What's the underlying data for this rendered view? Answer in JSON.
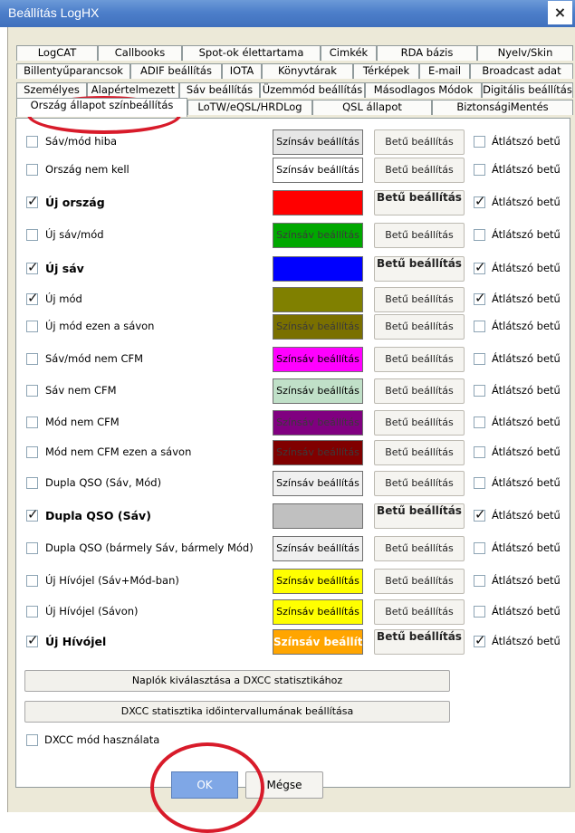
{
  "window": {
    "title": "Beállítás LogHX",
    "close_glyph": "×"
  },
  "tabs": {
    "row1": [
      "LogCAT",
      "Callbooks",
      "Spot-ok élettartama",
      "Cimkék",
      "RDA bázis",
      "Nyelv/Skin"
    ],
    "row2": [
      "Billentyűparancsok",
      "ADIF beállítás",
      "IOTA",
      "Könyvtárak",
      "Térképek",
      "E-mail",
      "Broadcast adat"
    ],
    "row3": [
      "Személyes",
      "Alapértelmezett",
      "Sáv beállítás",
      "Üzemmód beállítás",
      "Másodlagos Módok",
      "Digitális beállítás"
    ],
    "row4": [
      "Ország állapot színbeállítás",
      "LoTW/eQSL/HRDLog",
      "QSL állapot",
      "BiztonságiMentés"
    ]
  },
  "rows": [
    {
      "label": "Sáv/mód hiba",
      "checked": false,
      "bold_label": false,
      "color_btn": "Színsáv beállítás",
      "color": "#e6e6e6",
      "font_btn": "Betű beállítás",
      "font_bold": false,
      "transp_label": "Átlátszó betű",
      "transp_checked": false
    },
    {
      "label": "Ország nem kell",
      "checked": false,
      "bold_label": false,
      "color_btn": "Színsáv beállítás",
      "color": "#ffffff",
      "font_btn": "Betű beállítás",
      "font_bold": false,
      "transp_label": "Átlátszó betű",
      "transp_checked": false
    },
    {
      "label": "Új ország",
      "checked": true,
      "bold_label": true,
      "color_btn": "",
      "color": "#ff0000",
      "font_btn": "Betű beállítás",
      "font_bold": true,
      "transp_label": "Átlátszó betű",
      "transp_checked": true
    },
    {
      "label": "Új sáv/mód",
      "checked": false,
      "bold_label": false,
      "color_btn": "Színsáv beállítás",
      "color": "#00a800",
      "font_btn": "Betű beállítás",
      "font_bold": false,
      "transp_label": "Átlátszó betű",
      "transp_checked": false
    },
    {
      "label": "Új sáv",
      "checked": true,
      "bold_label": true,
      "color_btn": "",
      "color": "#0000ff",
      "font_btn": "Betű beállítás",
      "font_bold": true,
      "transp_label": "Átlátszó betű",
      "transp_checked": true
    },
    {
      "label": "Új mód",
      "checked": true,
      "bold_label": false,
      "color_btn": "",
      "color": "#808000",
      "font_btn": "Betű beállítás",
      "font_bold": false,
      "transp_label": "Átlátszó betű",
      "transp_checked": true
    },
    {
      "label": "Új mód ezen a sávon",
      "checked": false,
      "bold_label": false,
      "color_btn": "Színsáv beállítás",
      "color": "#7a7000",
      "font_btn": "Betű beállítás",
      "font_bold": false,
      "transp_label": "Átlátszó betű",
      "transp_checked": false
    },
    {
      "label": "Sáv/mód nem CFM",
      "checked": false,
      "bold_label": false,
      "color_btn": "Színsáv beállítás",
      "color": "#ff00ff",
      "font_btn": "Betű beállítás",
      "font_bold": false,
      "transp_label": "Átlátszó betű",
      "transp_checked": false
    },
    {
      "label": "Sáv nem CFM",
      "checked": false,
      "bold_label": false,
      "color_btn": "Színsáv beállítás",
      "color": "#c0e0c8",
      "font_btn": "Betű beállítás",
      "font_bold": false,
      "transp_label": "Átlátszó betű",
      "transp_checked": false
    },
    {
      "label": "Mód nem CFM",
      "checked": false,
      "bold_label": false,
      "color_btn": "Színsáv beállítás",
      "color": "#800080",
      "font_btn": "Betű beállítás",
      "font_bold": false,
      "transp_label": "Átlátszó betű",
      "transp_checked": false
    },
    {
      "label": "Mód nem CFM ezen a sávon",
      "checked": false,
      "bold_label": false,
      "color_btn": "Színsáv beállítás",
      "color": "#800000",
      "font_btn": "Betű beállítás",
      "font_bold": false,
      "transp_label": "Átlátszó betű",
      "transp_checked": false
    },
    {
      "label": "Dupla QSO (Sáv, Mód)",
      "checked": false,
      "bold_label": false,
      "color_btn": "Színsáv beállítás",
      "color": "#f0f0f0",
      "font_btn": "Betű beállítás",
      "font_bold": false,
      "transp_label": "Átlátszó betű",
      "transp_checked": false
    },
    {
      "label": "Dupla QSO (Sáv)",
      "checked": true,
      "bold_label": true,
      "color_btn": "",
      "color": "#c0c0c0",
      "font_btn": "Betű beállítás",
      "font_bold": true,
      "transp_label": "Átlátszó betű",
      "transp_checked": true
    },
    {
      "label": "Dupla QSO (bármely Sáv, bármely Mód)",
      "checked": false,
      "bold_label": false,
      "color_btn": "Színsáv beállítás",
      "color": "#f0f0f0",
      "font_btn": "Betű beállítás",
      "font_bold": false,
      "transp_label": "Átlátszó betű",
      "transp_checked": false
    },
    {
      "label": "Új Hívójel (Sáv+Mód-ban)",
      "checked": false,
      "bold_label": false,
      "color_btn": "Színsáv beállítás",
      "color": "#ffff00",
      "font_btn": "Betű beállítás",
      "font_bold": false,
      "transp_label": "Átlátszó betű",
      "transp_checked": false
    },
    {
      "label": "Új Hívójel (Sávon)",
      "checked": false,
      "bold_label": false,
      "color_btn": "Színsáv beállítás",
      "color": "#ffff00",
      "font_btn": "Betű beállítás",
      "font_bold": false,
      "transp_label": "Átlátszó betű",
      "transp_checked": false
    },
    {
      "label": "Új Hívójel",
      "checked": true,
      "bold_label": true,
      "color_btn": "Színsáv beállítá",
      "color": "#ffa500",
      "font_btn": "Betű beállítás",
      "font_bold": true,
      "transp_label": "Átlátszó betű",
      "transp_checked": true
    }
  ],
  "footer": {
    "log_select_btn": "Naplók kiválasztása a DXCC statisztikához",
    "interval_btn": "DXCC statisztika időintervallumának beállítása",
    "dxcc_mode_label": "DXCC mód használata",
    "dxcc_mode_checked": false,
    "ok_label": "OK",
    "cancel_label": "Mégse"
  },
  "colors": {
    "titlebar": "#4d7fca",
    "highlight_ring": "#d81b2a",
    "ok_button": "#7fa7e6"
  }
}
